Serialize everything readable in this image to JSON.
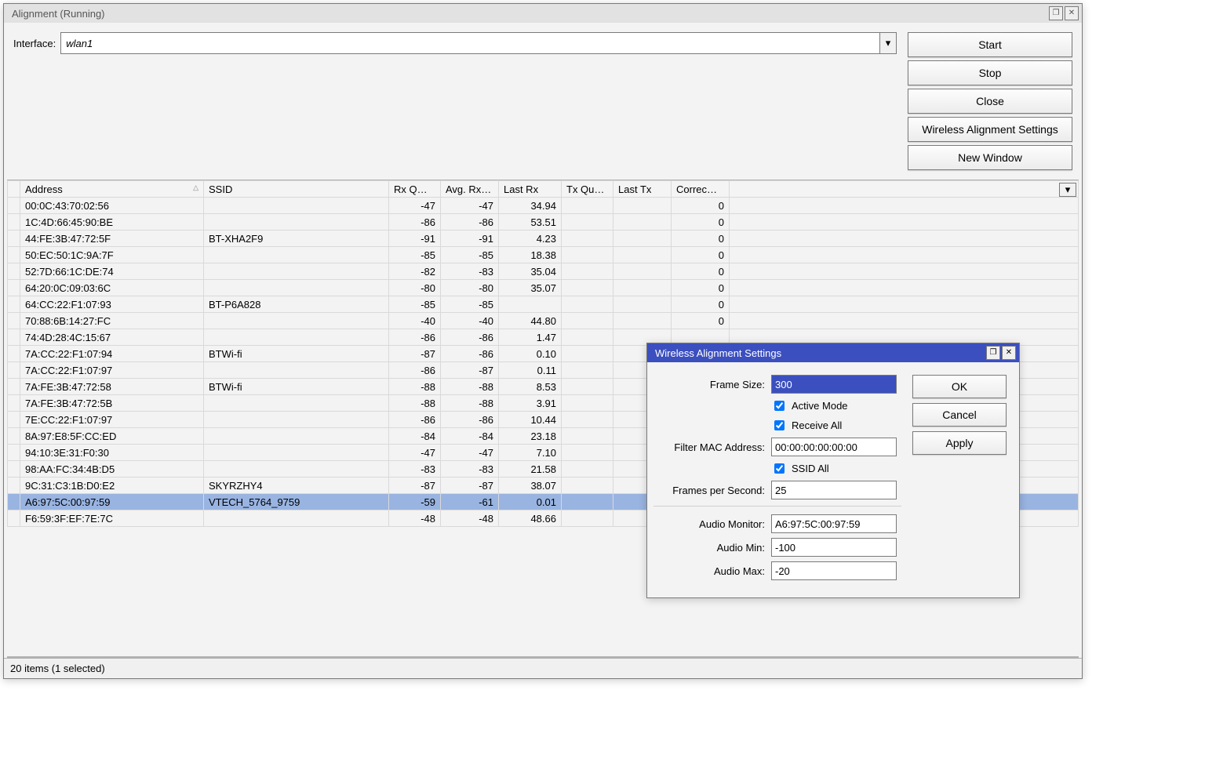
{
  "window": {
    "title": "Alignment (Running)",
    "interface_label": "Interface:",
    "interface_value": "wlan1",
    "buttons": {
      "start": "Start",
      "stop": "Stop",
      "close": "Close",
      "settings": "Wireless Alignment Settings",
      "new_window": "New Window"
    },
    "status": "20 items (1 selected)"
  },
  "columns": {
    "address": "Address",
    "ssid": "SSID",
    "rxq": "Rx Q…",
    "avgrx": "Avg. Rx…",
    "lastrx": "Last Rx",
    "txq": "Tx Qu…",
    "lasttx": "Last Tx",
    "correc": "Correc…"
  },
  "rows": [
    {
      "address": "00:0C:43:70:02:56",
      "ssid": "",
      "rxq": "-47",
      "avgrx": "-47",
      "lastrx": "34.94",
      "txq": "",
      "lasttx": "",
      "correc": "0"
    },
    {
      "address": "1C:4D:66:45:90:BE",
      "ssid": "",
      "rxq": "-86",
      "avgrx": "-86",
      "lastrx": "53.51",
      "txq": "",
      "lasttx": "",
      "correc": "0"
    },
    {
      "address": "44:FE:3B:47:72:5F",
      "ssid": "BT-XHA2F9",
      "rxq": "-91",
      "avgrx": "-91",
      "lastrx": "4.23",
      "txq": "",
      "lasttx": "",
      "correc": "0"
    },
    {
      "address": "50:EC:50:1C:9A:7F",
      "ssid": "",
      "rxq": "-85",
      "avgrx": "-85",
      "lastrx": "18.38",
      "txq": "",
      "lasttx": "",
      "correc": "0"
    },
    {
      "address": "52:7D:66:1C:DE:74",
      "ssid": "",
      "rxq": "-82",
      "avgrx": "-83",
      "lastrx": "35.04",
      "txq": "",
      "lasttx": "",
      "correc": "0"
    },
    {
      "address": "64:20:0C:09:03:6C",
      "ssid": "",
      "rxq": "-80",
      "avgrx": "-80",
      "lastrx": "35.07",
      "txq": "",
      "lasttx": "",
      "correc": "0"
    },
    {
      "address": "64:CC:22:F1:07:93",
      "ssid": "BT-P6A828",
      "rxq": "-85",
      "avgrx": "-85",
      "lastrx": "",
      "txq": "",
      "lasttx": "",
      "correc": "0"
    },
    {
      "address": "70:88:6B:14:27:FC",
      "ssid": "",
      "rxq": "-40",
      "avgrx": "-40",
      "lastrx": "44.80",
      "txq": "",
      "lasttx": "",
      "correc": "0"
    },
    {
      "address": "74:4D:28:4C:15:67",
      "ssid": "",
      "rxq": "-86",
      "avgrx": "-86",
      "lastrx": "1.47",
      "txq": "",
      "lasttx": "",
      "correc": ""
    },
    {
      "address": "7A:CC:22:F1:07:94",
      "ssid": "BTWi-fi",
      "rxq": "-87",
      "avgrx": "-86",
      "lastrx": "0.10",
      "txq": "",
      "lasttx": "",
      "correc": ""
    },
    {
      "address": "7A:CC:22:F1:07:97",
      "ssid": "",
      "rxq": "-86",
      "avgrx": "-87",
      "lastrx": "0.11",
      "txq": "",
      "lasttx": "",
      "correc": ""
    },
    {
      "address": "7A:FE:3B:47:72:58",
      "ssid": "BTWi-fi",
      "rxq": "-88",
      "avgrx": "-88",
      "lastrx": "8.53",
      "txq": "",
      "lasttx": "",
      "correc": ""
    },
    {
      "address": "7A:FE:3B:47:72:5B",
      "ssid": "",
      "rxq": "-88",
      "avgrx": "-88",
      "lastrx": "3.91",
      "txq": "",
      "lasttx": "",
      "correc": ""
    },
    {
      "address": "7E:CC:22:F1:07:97",
      "ssid": "",
      "rxq": "-86",
      "avgrx": "-86",
      "lastrx": "10.44",
      "txq": "",
      "lasttx": "",
      "correc": ""
    },
    {
      "address": "8A:97:E8:5F:CC:ED",
      "ssid": "",
      "rxq": "-84",
      "avgrx": "-84",
      "lastrx": "23.18",
      "txq": "",
      "lasttx": "",
      "correc": ""
    },
    {
      "address": "94:10:3E:31:F0:30",
      "ssid": "",
      "rxq": "-47",
      "avgrx": "-47",
      "lastrx": "7.10",
      "txq": "",
      "lasttx": "",
      "correc": ""
    },
    {
      "address": "98:AA:FC:34:4B:D5",
      "ssid": "",
      "rxq": "-83",
      "avgrx": "-83",
      "lastrx": "21.58",
      "txq": "",
      "lasttx": "",
      "correc": ""
    },
    {
      "address": "9C:31:C3:1B:D0:E2",
      "ssid": "SKYRZHY4",
      "rxq": "-87",
      "avgrx": "-87",
      "lastrx": "38.07",
      "txq": "",
      "lasttx": "",
      "correc": ""
    },
    {
      "address": "A6:97:5C:00:97:59",
      "ssid": "VTECH_5764_9759",
      "rxq": "-59",
      "avgrx": "-61",
      "lastrx": "0.01",
      "txq": "",
      "lasttx": "",
      "correc": "",
      "selected": true
    },
    {
      "address": "F6:59:3F:EF:7E:7C",
      "ssid": "",
      "rxq": "-48",
      "avgrx": "-48",
      "lastrx": "48.66",
      "txq": "",
      "lasttx": "",
      "correc": ""
    }
  ],
  "dialog": {
    "title": "Wireless Alignment Settings",
    "labels": {
      "frame_size": "Frame Size:",
      "active_mode": "Active Mode",
      "receive_all": "Receive All",
      "filter_mac": "Filter MAC Address:",
      "ssid_all": "SSID All",
      "fps": "Frames per Second:",
      "audio_monitor": "Audio Monitor:",
      "audio_min": "Audio Min:",
      "audio_max": "Audio Max:"
    },
    "values": {
      "frame_size": "300",
      "active_mode": true,
      "receive_all": true,
      "filter_mac": "00:00:00:00:00:00",
      "ssid_all": true,
      "fps": "25",
      "audio_monitor": "A6:97:5C:00:97:59",
      "audio_min": "-100",
      "audio_max": "-20"
    },
    "buttons": {
      "ok": "OK",
      "cancel": "Cancel",
      "apply": "Apply"
    }
  }
}
